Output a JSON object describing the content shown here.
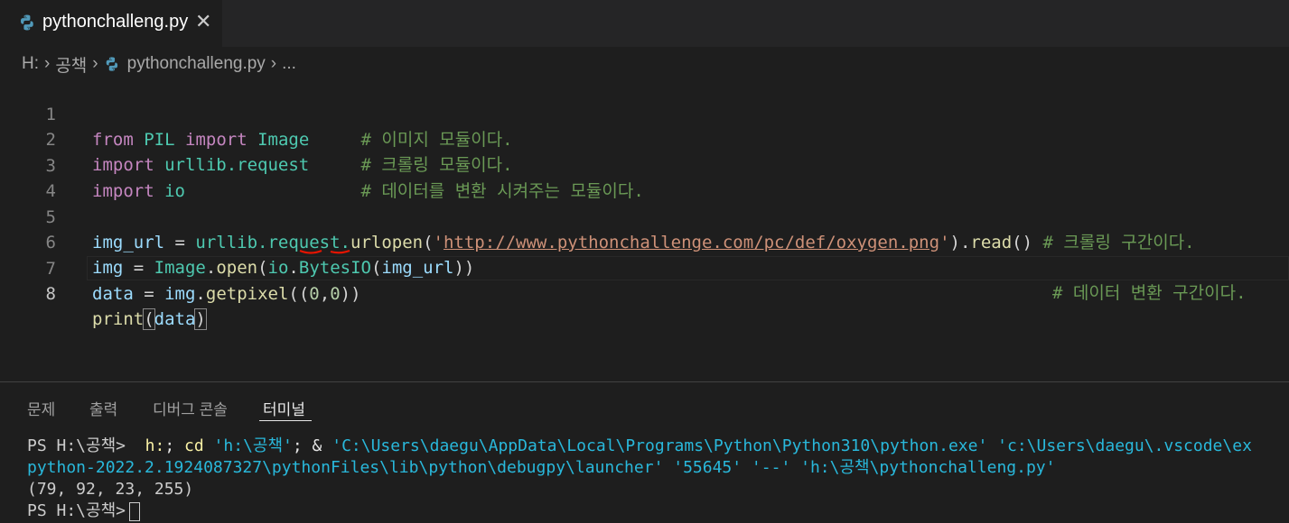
{
  "tab": {
    "filename": "pythonchalleng.py",
    "close_glyph": "✕"
  },
  "breadcrumb": {
    "drive": "H:",
    "folder": "공책",
    "file": "pythonchalleng.py",
    "more": "..."
  },
  "editor": {
    "lines": [
      {
        "n": "1"
      },
      {
        "n": "2"
      },
      {
        "n": "3"
      },
      {
        "n": "4"
      },
      {
        "n": "5"
      },
      {
        "n": "6"
      },
      {
        "n": "7"
      },
      {
        "n": "8"
      }
    ],
    "code": {
      "l1_from": "from",
      "l1_mod": "PIL",
      "l1_import": "import",
      "l1_cls": "Image",
      "l1_comment": "# 이미지 모듈이다.",
      "l2_import": "import",
      "l2_mod": "urllib.request",
      "l2_comment": "# 크롤링 모듈이다.",
      "l3_import": "import",
      "l3_mod": "io",
      "l3_comment": "# 데이터를 변환 시켜주는 모듈이다.",
      "l5_var": "img_url",
      "l5_eq": " = ",
      "l5_obj": "urllib.request.",
      "l5_fn": "urlopen",
      "l5_open": "(",
      "l5_q1": "'",
      "l5_url": "http://www.pythonchallenge.com/pc/def/oxygen.png",
      "l5_q2": "'",
      "l5_close": ").",
      "l5_read": "read",
      "l5_paren": "()",
      "l5_comment": " # 크롤링 구간이다.",
      "l6_var": "img",
      "l6_eq": " = ",
      "l6_cls": "Image",
      "l6_dot": ".",
      "l6_fn": "open",
      "l6_p1": "(",
      "l6_io": "io",
      "l6_dot2": ".",
      "l6_bio": "BytesIO",
      "l6_p2": "(",
      "l6_arg": "img_url",
      "l6_p3": "))",
      "l6_comment": "# 데이터 변환 구간이다.",
      "l7_var": "data",
      "l7_eq": " = ",
      "l7_obj": "img",
      "l7_dot": ".",
      "l7_fn": "getpixel",
      "l7_p1": "((",
      "l7_n1": "0",
      "l7_comma": ",",
      "l7_n2": "0",
      "l7_p2": "))",
      "l8_fn": "print",
      "l8_p1": "(",
      "l8_arg": "data",
      "l8_p2": ")"
    }
  },
  "panel": {
    "tabs": [
      "문제",
      "출력",
      "디버그 콘솔",
      "터미널"
    ],
    "terminal": {
      "prompt1": "PS H:\\공책> ",
      "cmd_h": " h:",
      "cmd_sep1": "; ",
      "cmd_cd": "cd",
      "cmd_path1": " 'h:\\공책'",
      "cmd_sep2": "; & ",
      "cmd_exe": "'C:\\Users\\daegu\\AppData\\Local\\Programs\\Python\\Python310\\python.exe'",
      "cmd_ext": " 'c:\\Users\\daegu\\.vscode\\ex",
      "line2": "python-2022.2.1924087327\\pythonFiles\\lib\\python\\debugpy\\launcher' '55645' '--' 'h:\\공책\\pythonchalleng.py'",
      "output": "(79, 92, 23, 255)",
      "prompt2": "PS H:\\공책>"
    }
  },
  "colors": {
    "keyword": "#c586c0",
    "class": "#4ec9b0",
    "comment": "#6a9955",
    "string": "#ce9178",
    "squiggle": "#e51400"
  }
}
